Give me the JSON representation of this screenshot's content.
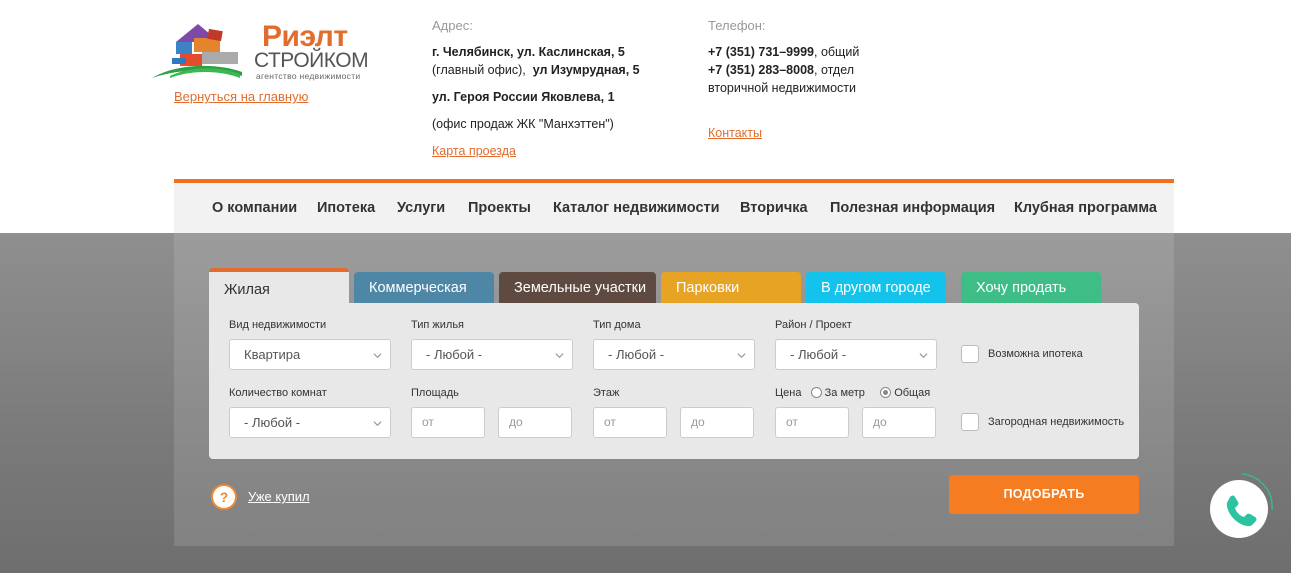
{
  "logo": {
    "title": "Риэлт",
    "subtitle": "СТРОЙКОМ",
    "tagline": "агентство недвижимости"
  },
  "header": {
    "back_link": "Вернуться на главную",
    "address": {
      "label": "Адрес:",
      "line1_bold": "г. Челябинск, ул. Каслинская, 5",
      "line2_note": "(главный офис),",
      "line2_bold": "ул Изумрудная, 5",
      "line3_bold": "ул. Героя России Яковлева, 1",
      "line4_note": "(офис продаж ЖК \"Манхэттен\")",
      "map_link": "Карта проезда"
    },
    "phone": {
      "label": "Телефон:",
      "phone1": "+7 (351) 731–9999",
      "phone1_note": ", общий",
      "phone2": "+7 (351) 283–8008",
      "phone2_note": ", отдел",
      "phone2_note2": "вторичной недвижимости",
      "contacts_link": "Контакты"
    }
  },
  "nav": {
    "items": [
      "О компании",
      "Ипотека",
      "Услуги",
      "Проекты",
      "Каталог недвижимости",
      "Вторичка",
      "Полезная информация",
      "Клубная программа"
    ]
  },
  "tabs": [
    {
      "label": "Жилая",
      "color": "#e8e8e8",
      "active": true
    },
    {
      "label": "Коммерческая",
      "color": "#4e86a6"
    },
    {
      "label": "Земельные участки",
      "color": "#5e4a40"
    },
    {
      "label": "Парковки",
      "color": "#e7a324"
    },
    {
      "label": "В другом городе",
      "color": "#14c3eb"
    },
    {
      "label": "Хочу продать",
      "color": "#3fbd86"
    }
  ],
  "form": {
    "property_type": {
      "label": "Вид недвижимости",
      "value": "Квартира"
    },
    "housing_type": {
      "label": "Тип жилья",
      "value": "- Любой -"
    },
    "house_type": {
      "label": "Тип дома",
      "value": "- Любой -"
    },
    "district": {
      "label": "Район / Проект",
      "value": "- Любой -"
    },
    "mortgage": {
      "label": "Возможна ипотека",
      "checked": false
    },
    "rooms": {
      "label": "Количество комнат",
      "value": "- Любой -"
    },
    "area": {
      "label": "Площадь",
      "from": "от",
      "to": "до"
    },
    "floor": {
      "label": "Этаж",
      "from": "от",
      "to": "до"
    },
    "price": {
      "label": "Цена",
      "opt_meter": "За метр",
      "opt_total": "Общая",
      "selected": "Общая",
      "from": "от",
      "to": "до"
    },
    "country": {
      "label": "Загородная недвижимость",
      "checked": false
    }
  },
  "bottom": {
    "help_icon": "?",
    "bought_link": "Уже купил",
    "submit": "ПОДОБРАТЬ"
  },
  "colors": {
    "accent": "#f57c21",
    "link": "#e26c2d",
    "call_icon": "#2cc4a0"
  },
  "icons": [
    "phone-call-icon",
    "chevron-down-icon",
    "question-icon"
  ]
}
